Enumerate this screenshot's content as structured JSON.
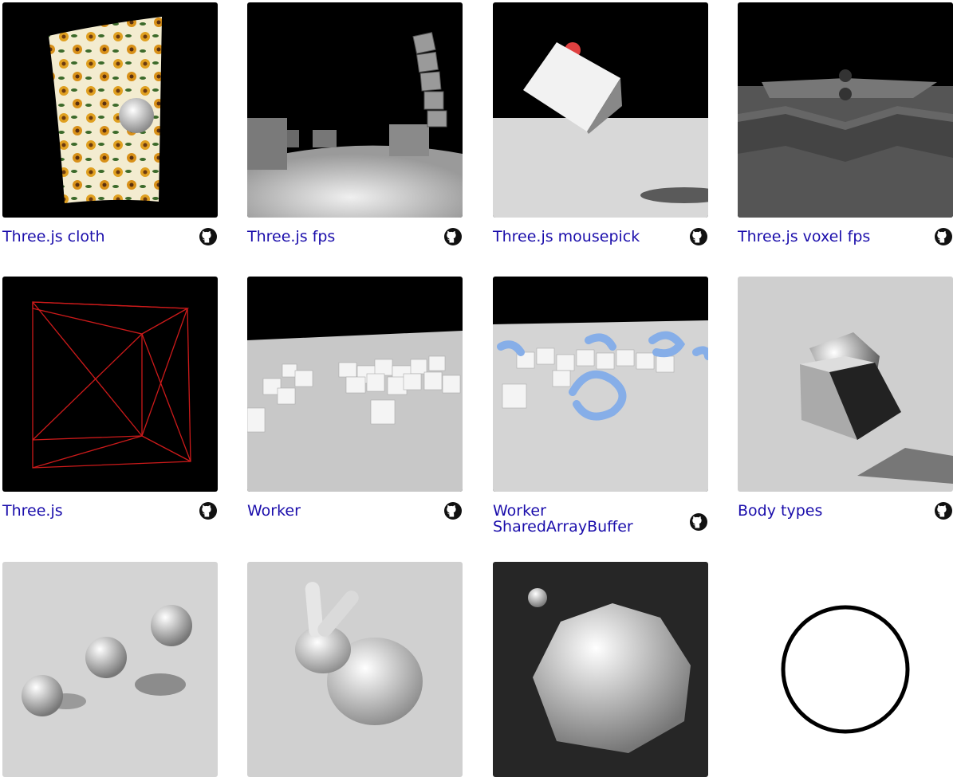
{
  "colors": {
    "link": "#1a0dab",
    "icon": "#111111",
    "background": "#ffffff"
  },
  "cards": [
    {
      "title": "Three.js cloth",
      "icon": "github-icon"
    },
    {
      "title": "Three.js fps",
      "icon": "github-icon"
    },
    {
      "title": "Three.js mousepick",
      "icon": "github-icon"
    },
    {
      "title": "Three.js voxel fps",
      "icon": "github-icon"
    },
    {
      "title": "Three.js",
      "icon": "github-icon"
    },
    {
      "title": "Worker",
      "icon": "github-icon"
    },
    {
      "title": "Worker SharedArrayBuffer",
      "icon": "github-icon"
    },
    {
      "title": "Body types",
      "icon": "github-icon"
    },
    {
      "title": "",
      "icon": ""
    },
    {
      "title": "",
      "icon": ""
    },
    {
      "title": "",
      "icon": ""
    },
    {
      "title": "",
      "icon": ""
    }
  ]
}
